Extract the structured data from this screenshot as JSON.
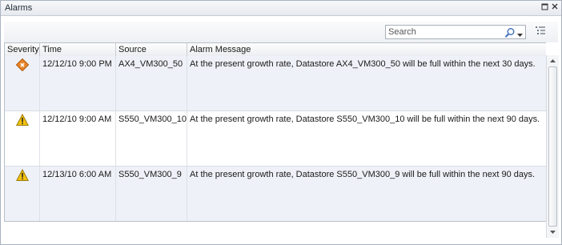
{
  "window": {
    "title": "Alarms",
    "restore_icon": "window-restore-icon",
    "close_icon": "close-icon"
  },
  "toolbar": {
    "search_placeholder": "Search",
    "search_value": "",
    "search_icon": "magnifier-icon",
    "view_options_icon": "list-options-icon"
  },
  "table": {
    "columns": [
      "Severity",
      "Time",
      "Source",
      "Alarm Message"
    ],
    "rows": [
      {
        "severity": "critical",
        "severity_icon": "critical-diamond-icon",
        "time": "12/12/10 9:00 PM",
        "source": "AX4_VM300_50",
        "message": "At the present growth rate, Datastore AX4_VM300_50 will be full within the next 30 days."
      },
      {
        "severity": "warning",
        "severity_icon": "warning-triangle-icon",
        "time": "12/12/10 9:00 AM",
        "source": "S550_VM300_10",
        "message": "At the present growth rate, Datastore S550_VM300_10 will be full within the next 90 days."
      },
      {
        "severity": "warning",
        "severity_icon": "warning-triangle-icon",
        "time": "12/13/10 6:00 AM",
        "source": "S550_VM300_9",
        "message": "At the present growth rate, Datastore S550_VM300_9 will be full within the next 90 days."
      }
    ]
  },
  "colors": {
    "row_alt": "#eef1f7",
    "critical": "#e8872a",
    "warning": "#f3c20f"
  }
}
